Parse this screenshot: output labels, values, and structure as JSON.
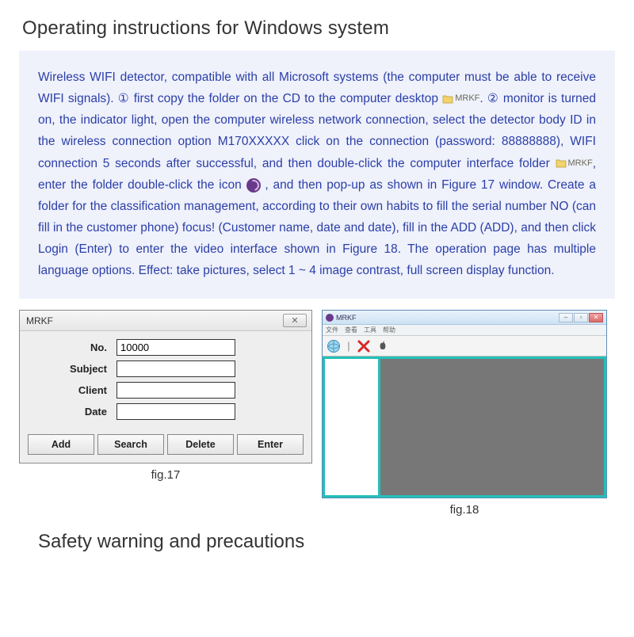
{
  "headings": {
    "h1": "Operating instructions for Windows system",
    "h2": "Safety warning and precautions"
  },
  "instructions": {
    "part1": "Wireless WIFI detector, compatible with all Microsoft systems (the computer must be able to receive WIFI signals). ① first copy the folder on the CD to the computer desktop",
    "folder_label": "MRKF",
    "part2": ". ② monitor is turned on, the indicator light, open the computer wireless network connection, select the detector body ID in the wireless connection option M170XXXXX click on the connection (password: 88888888), WIFI connection 5 seconds after successful, and then double-click the computer interface folder",
    "folder_label2": "MRKF",
    "part3": ", enter the folder double-click the icon ",
    "part4": " , and then pop-up as shown in Figure 17 window. Create a folder for the classification management, according to their own habits to fill the serial number NO (can fill in the customer phone) focus! (Customer name, date and date), fill in the ADD (ADD), and then click Login (Enter) to enter the video interface shown in Figure 18. The operation page has multiple language options. Effect: take pictures, select 1 ~ 4 image contrast, full screen display function."
  },
  "fig17": {
    "window_title": "MRKF",
    "close_glyph": "✕",
    "labels": {
      "no": "No.",
      "subject": "Subject",
      "client": "Client",
      "date": "Date"
    },
    "values": {
      "no": "10000",
      "subject": "",
      "client": "",
      "date": ""
    },
    "buttons": {
      "add": "Add",
      "search": "Search",
      "delete": "Delete",
      "enter": "Enter"
    },
    "caption": "fig.17"
  },
  "fig18": {
    "window_title": "MRKF",
    "menu": [
      "文件",
      "查看",
      "工具",
      "帮助"
    ],
    "toolbar_icons": [
      "globe-icon",
      "separator",
      "delete-x-icon",
      "apple-icon"
    ],
    "win_buttons": {
      "min": "–",
      "max": "▫",
      "close": "✕"
    },
    "caption": "fig.18"
  }
}
